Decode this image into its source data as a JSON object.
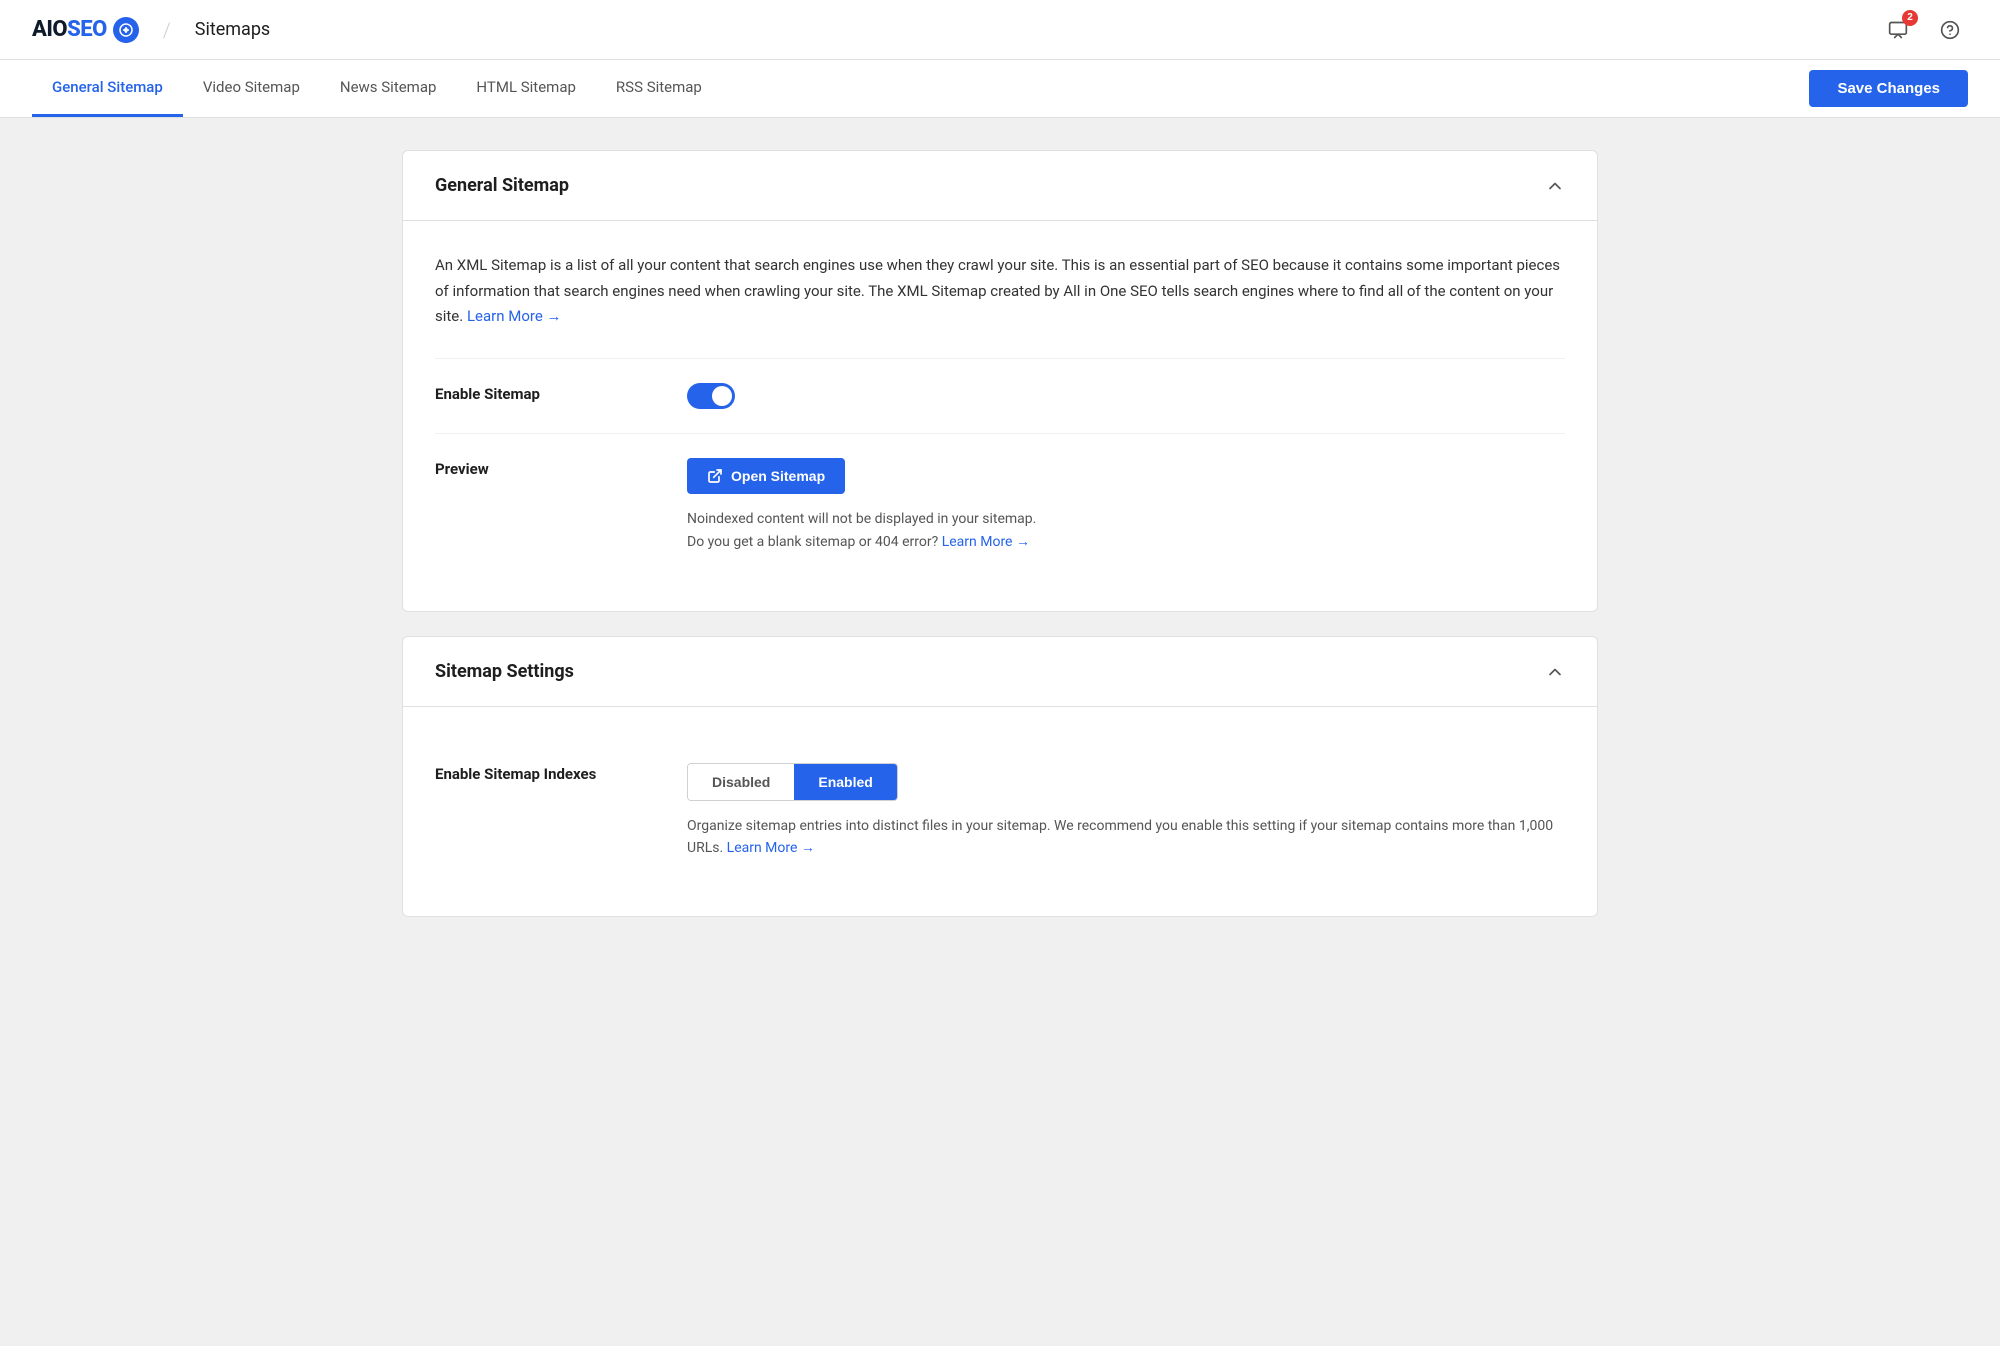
{
  "header": {
    "logo_aio": "AIO",
    "logo_seo": "SEO",
    "page_title": "Sitemaps",
    "notification_badge": "2"
  },
  "tabs": {
    "items": [
      {
        "id": "general",
        "label": "General Sitemap",
        "active": true
      },
      {
        "id": "video",
        "label": "Video Sitemap",
        "active": false
      },
      {
        "id": "news",
        "label": "News Sitemap",
        "active": false
      },
      {
        "id": "html",
        "label": "HTML Sitemap",
        "active": false
      },
      {
        "id": "rss",
        "label": "RSS Sitemap",
        "active": false
      }
    ],
    "save_label": "Save Changes"
  },
  "general_sitemap_card": {
    "title": "General Sitemap",
    "description": "An XML Sitemap is a list of all your content that search engines use when they crawl your site. This is an essential part of SEO because it contains some important pieces of information that search engines need when crawling your site. The XML Sitemap created by All in One SEO tells search engines where to find all of the content on your site.",
    "learn_more_link": "Learn More →",
    "enable_sitemap_label": "Enable Sitemap",
    "preview_label": "Preview",
    "open_sitemap_label": "Open Sitemap",
    "preview_note_line1": "Noindexed content will not be displayed in your sitemap.",
    "preview_note_line2": "Do you get a blank sitemap or 404 error?",
    "preview_learn_more": "Learn More →"
  },
  "sitemap_settings_card": {
    "title": "Sitemap Settings",
    "enable_indexes_label": "Enable Sitemap Indexes",
    "disabled_label": "Disabled",
    "enabled_label": "Enabled",
    "indexes_hint": "Organize sitemap entries into distinct files in your sitemap. We recommend you enable this setting if your sitemap contains more than 1,000 URLs.",
    "indexes_learn_more": "Learn More →"
  }
}
